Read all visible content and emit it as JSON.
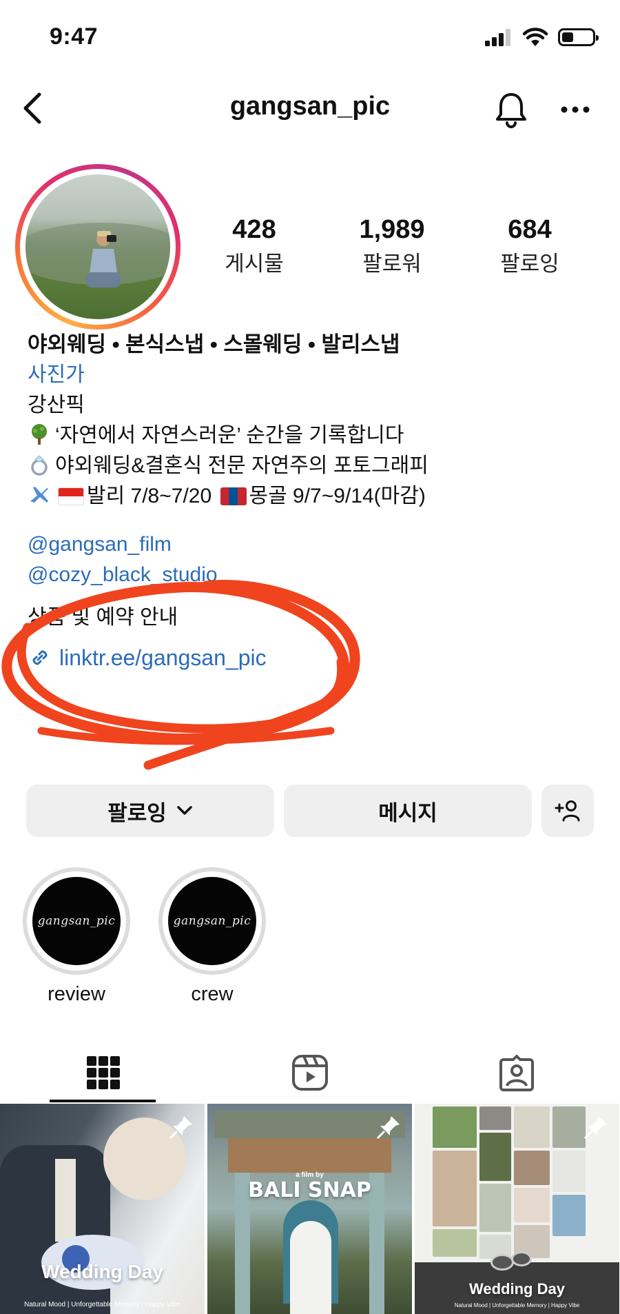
{
  "status": {
    "time": "9:47"
  },
  "nav": {
    "username": "gangsan_pic"
  },
  "stats": [
    {
      "num": "428",
      "label": "게시물"
    },
    {
      "num": "1,989",
      "label": "팔로워"
    },
    {
      "num": "684",
      "label": "팔로잉"
    }
  ],
  "bio": {
    "name": "야외웨딩 • 본식스냅 • 스몰웨딩 • 발리스냅",
    "category": "사진가",
    "line1": "강산픽",
    "line2": "‘자연에서 자연스러운’ 순간을 기록합니다",
    "line3": "야외웨딩&결혼식 전문 자연주의 포토그래피",
    "line4a": "발리 7/8~7/20",
    "line4b": "몽골 9/7~9/14(마감)",
    "mention1": "@gangsan_film",
    "mention2": "@cozy_black_studio",
    "booking": "상품 및 예약 안내",
    "link": "linktr.ee/gangsan_pic"
  },
  "buttons": {
    "follow": "팔로잉",
    "message": "메시지"
  },
  "highlights": [
    {
      "label": "review",
      "cover_text": "gangsan_pic"
    },
    {
      "label": "crew",
      "cover_text": "gangsan_pic"
    }
  ],
  "grid": [
    {
      "title": "Wedding Day",
      "subtitle": "Natural Mood | Unforgettable Memory | Happy Vibe"
    },
    {
      "title": "BALI SNAP",
      "subtitle": "a film by"
    },
    {
      "title": "Wedding Day",
      "subtitle": "Natural Mood | Unforgettable Memory | Happy Vibe"
    }
  ],
  "colors": {
    "link_blue": "#2b6cb8",
    "scribble": "#f0441f",
    "button_bg": "#efefef"
  }
}
